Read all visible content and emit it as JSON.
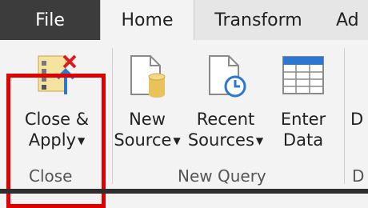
{
  "tabs": {
    "file": "File",
    "home": "Home",
    "transform": "Transform",
    "add_column": "Ad"
  },
  "close_group": {
    "label": "Close",
    "close_apply_line1": "Close &",
    "close_apply_line2": "Apply"
  },
  "new_query_group": {
    "label": "New Query",
    "new_source_line1": "New",
    "new_source_line2": "Source",
    "recent_sources_line1": "Recent",
    "recent_sources_line2": "Sources",
    "enter_data_line1": "Enter",
    "enter_data_line2": "Data"
  },
  "next_group": {
    "label": "D",
    "button_partial": "D"
  },
  "colors": {
    "highlight": "#e00000",
    "accent_blue": "#2b77d3",
    "cylinder": "#e8c35a",
    "file_tab_bg": "#3c3c3c"
  }
}
